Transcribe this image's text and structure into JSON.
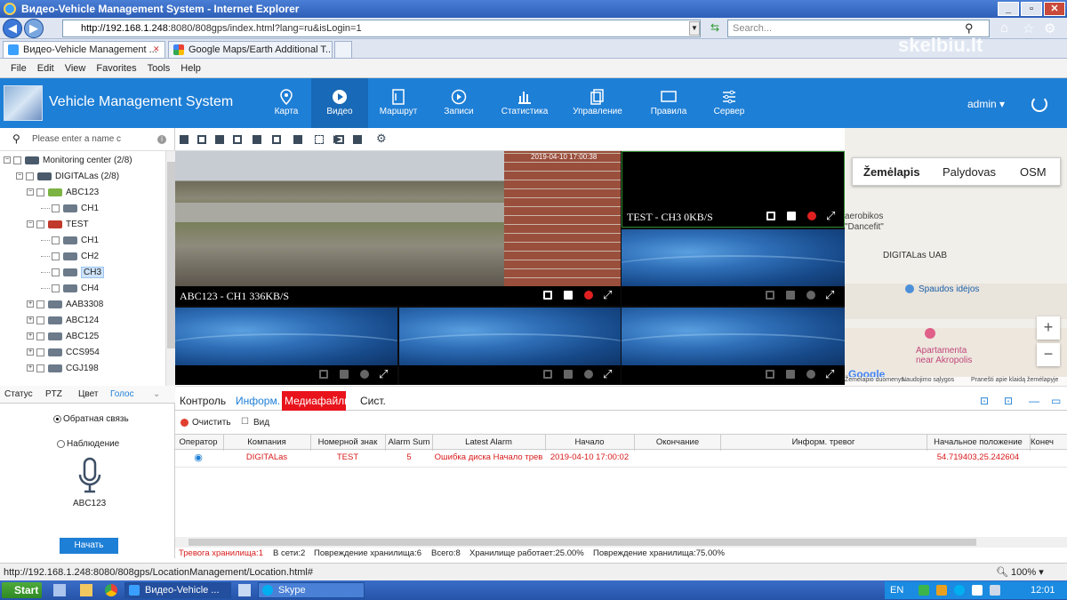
{
  "window": {
    "title": "Видео-Vehicle Management System - Internet Explorer"
  },
  "address": {
    "host": "http://192.168.1.248",
    "rest": ":8080/808gps/index.html?lang=ru&isLogin=1",
    "search_placeholder": "Search..."
  },
  "tabs": [
    {
      "label": "Видео-Vehicle Management ..."
    },
    {
      "label": "Google Maps/Earth Additional T..."
    }
  ],
  "menu": [
    "File",
    "Edit",
    "View",
    "Favorites",
    "Tools",
    "Help"
  ],
  "watermark": "skelbiu.lt",
  "app": {
    "title": "Vehicle Management System",
    "nav": [
      {
        "label": "Карта"
      },
      {
        "label": "Видео"
      },
      {
        "label": "Маршрут"
      },
      {
        "label": "Записи"
      },
      {
        "label": "Статистика"
      },
      {
        "label": "Управление"
      },
      {
        "label": "Правила"
      },
      {
        "label": "Сервер"
      }
    ],
    "user": "admin",
    "active_nav": "Видео"
  },
  "tree": {
    "search_placeholder": "Please enter a name c",
    "rows": [
      {
        "label": "Monitoring center  (2/8)"
      },
      {
        "label": "DIGITALas  (2/8)"
      },
      {
        "label": "ABC123"
      },
      {
        "label": "CH1"
      },
      {
        "label": "TEST"
      },
      {
        "label": "CH1"
      },
      {
        "label": "CH2"
      },
      {
        "label": "CH3"
      },
      {
        "label": "CH4"
      },
      {
        "label": "AAB3308"
      },
      {
        "label": "ABC124"
      },
      {
        "label": "ABC125"
      },
      {
        "label": "CCS954"
      },
      {
        "label": "CGJ198"
      }
    ]
  },
  "left_tabs": [
    "Статус",
    "PTZ",
    "Цвет",
    "Голос"
  ],
  "audio": {
    "option1": "Обратная связь",
    "option2": "Наблюдение",
    "device": "ABC123",
    "start": "Начать"
  },
  "video": {
    "cells": [
      {
        "caption": "ABC123 - CH1 336KB/S"
      },
      {
        "caption": "TEST - CH3 0KB/S"
      }
    ],
    "timestamp": "2019-04-10 17:00:38"
  },
  "map": {
    "tabs": [
      "Žemėlapis",
      "Palydovas",
      "OSM"
    ],
    "labels": [
      "aerobikos",
      "\"Dancefit\"",
      "DIGITALas UAB",
      "Spaudos idėjos",
      "Apartamenta",
      "near Akropolis"
    ],
    "footer": [
      "Žemėlapio duomenys",
      "Naudojimo sąlygos",
      "Pranešti apie klaidą žemėlapyje"
    ],
    "zoom_in": "+",
    "zoom_out": "−",
    "google": "Google"
  },
  "bottom": {
    "tabs": [
      "Контроль",
      "Информ.",
      "Медиафайлы",
      "Сист."
    ],
    "clear": "Очистить",
    "view": "Вид",
    "columns": [
      "Оператор",
      "Компания",
      "Номерной знак",
      "Alarm Sum",
      "Latest Alarm",
      "Начало",
      "Окончание",
      "Информ. тревог",
      "Начальное положение",
      "Конеч"
    ],
    "row": {
      "company": "DIGITALas",
      "plate": "TEST",
      "sum": "5",
      "latest": "Ошибка диска Начало трев",
      "start": "2019-04-10 17:00:02",
      "end": "",
      "info": "",
      "position": "54.719403,25.242604"
    },
    "status": {
      "alarm": "Тревога хранилища:1",
      "online": "В сети:2",
      "damage": "Повреждение хранилища:6",
      "total": "Всего:8",
      "working": "Хранилище работает:25.00%",
      "damage_pct": "Повреждение хранилища:75.00%"
    }
  },
  "ie_status": {
    "url": "http://192.168.1.248:8080/808gps/LocationManagement/Location.html#",
    "zoom": "100%"
  },
  "taskbar": {
    "start": "Start",
    "items": [
      "Видео-Vehicle ...",
      "Skype"
    ],
    "lang": "EN",
    "time": "12:01"
  },
  "colors": {
    "accent": "#1e7fd6",
    "alarm": "#d81b1b",
    "media_tab": "#e8131b"
  }
}
